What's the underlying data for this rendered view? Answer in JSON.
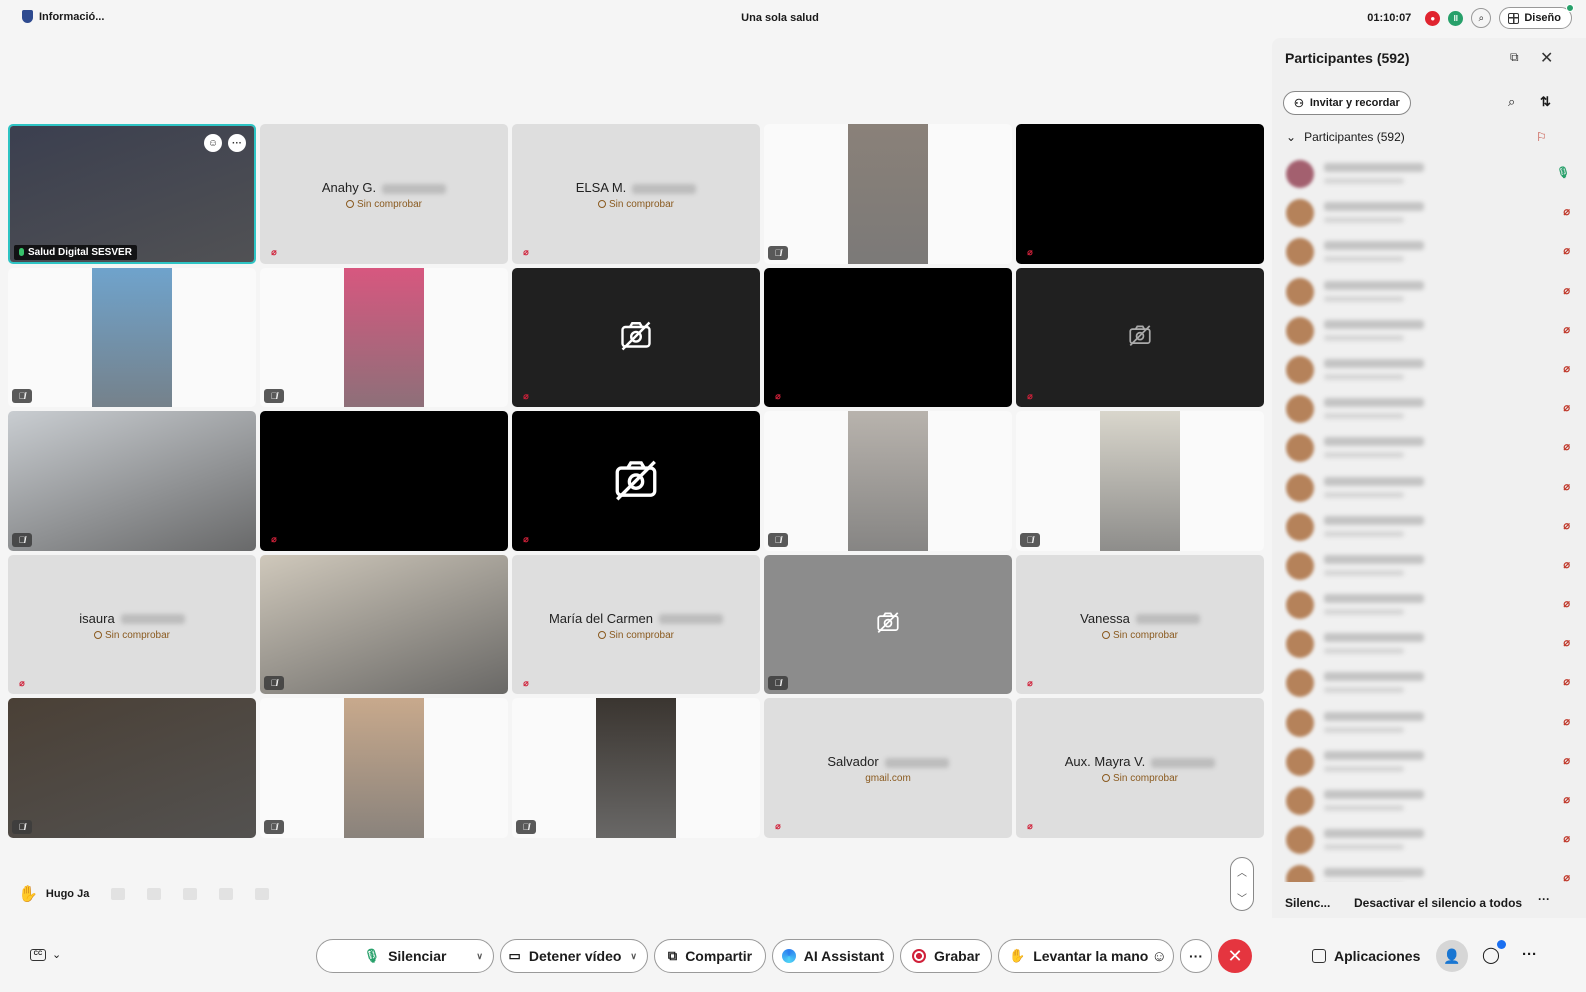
{
  "topbar": {
    "info_label": "Informació...",
    "meeting_title": "Una sola salud",
    "timer": "01:10:07",
    "layout_button": "Diseño"
  },
  "tiles": [
    {
      "kind": "video",
      "bg": "#3b3f4f",
      "name_tag": "Salud Digital SESVER",
      "active": true
    },
    {
      "kind": "name",
      "first": "Anahy G.",
      "status": "Sin comprobar"
    },
    {
      "kind": "name",
      "first": "ELSA M.",
      "status": "Sin comprobar"
    },
    {
      "kind": "portrait",
      "bg": "#8a8179"
    },
    {
      "kind": "black"
    },
    {
      "kind": "portrait",
      "bg": "#6fa3cc"
    },
    {
      "kind": "portrait",
      "bg": "#d7577f"
    },
    {
      "kind": "camoff-dark"
    },
    {
      "kind": "black"
    },
    {
      "kind": "camoff-dark-small"
    },
    {
      "kind": "video",
      "bg": "#c9cdd1"
    },
    {
      "kind": "black"
    },
    {
      "kind": "camoff-black"
    },
    {
      "kind": "portrait",
      "bg": "#b8b3ad"
    },
    {
      "kind": "portrait",
      "bg": "#d9d6cc"
    },
    {
      "kind": "name",
      "first": "isaura",
      "status": "Sin comprobar"
    },
    {
      "kind": "video",
      "bg": "#cfc8bb"
    },
    {
      "kind": "name",
      "first": "María del Carmen",
      "status": "Sin comprobar"
    },
    {
      "kind": "camoff-mid"
    },
    {
      "kind": "name",
      "first": "Vanessa",
      "status": "Sin comprobar"
    },
    {
      "kind": "video",
      "bg": "#4a4036"
    },
    {
      "kind": "portrait",
      "bg": "#c8a98c"
    },
    {
      "kind": "portrait",
      "bg": "#3a3530"
    },
    {
      "kind": "name",
      "first": "Salvador",
      "status": "gmail.com"
    },
    {
      "kind": "name",
      "first": "Aux. Mayra V.",
      "status": "Sin comprobar"
    }
  ],
  "reaction": {
    "name": "Hugo Ja"
  },
  "toolbar": {
    "cc_label": "CC",
    "mute": "Silenciar",
    "video": "Detener vídeo",
    "share": "Compartir",
    "ai": "AI Assistant",
    "record": "Grabar",
    "raise_hand": "Levantar la mano",
    "apps": "Aplicaciones"
  },
  "participants_panel": {
    "title": "Participantes (592)",
    "invite": "Invitar y recordar",
    "group_label": "Participantes (592)",
    "mute_all": "Silenc...",
    "unmute_all": "Desactivar el silencio a todos",
    "rows": 19
  },
  "colors": {
    "accent_teal": "#2ec4c4",
    "leave_red": "#e5353f",
    "status_brown": "#8a5a1f",
    "mute_red": "#d0213a"
  }
}
